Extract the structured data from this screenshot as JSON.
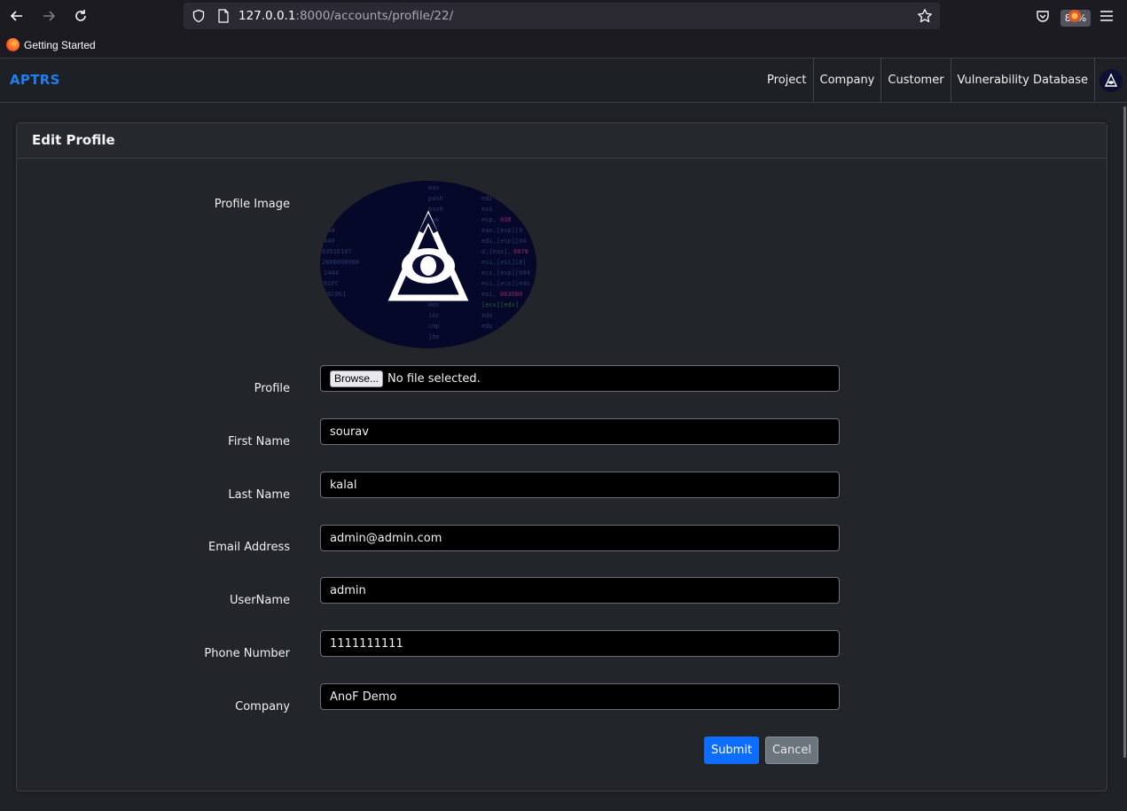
{
  "browser": {
    "url_host": "127.0.0.1",
    "url_rest": ":8000/accounts/profile/22/",
    "zoom": "80%",
    "bookmark_label": "Getting Started"
  },
  "navbar": {
    "brand": "APTRS",
    "links": [
      "Project",
      "Company",
      "Customer",
      "Vulnerability Database"
    ]
  },
  "card": {
    "title": "Edit Profile"
  },
  "form": {
    "profile_image_label": "Profile Image",
    "profile_label": "Profile",
    "browse_label": "Browse...",
    "file_status": "No file selected.",
    "first_name_label": "First Name",
    "first_name_value": "sourav",
    "last_name_label": "Last Name",
    "last_name_value": "kalal",
    "email_label": "Email Address",
    "email_value": "admin@admin.com",
    "username_label": "UserName",
    "username_value": "admin",
    "phone_label": "Phone Number",
    "phone_value": "1111111111",
    "company_label": "Company",
    "company_value": "AnoF Demo",
    "submit_label": "Submit",
    "cancel_label": "Cancel"
  },
  "colors": {
    "brand": "#1e7ff0",
    "submit": "#0d6efd",
    "cancel": "#6c757d",
    "background": "#1f2226"
  }
}
